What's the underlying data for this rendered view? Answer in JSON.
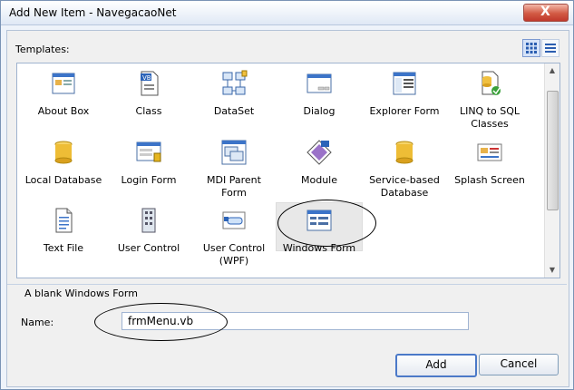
{
  "window": {
    "title": "Add New Item - NavegacaoNet",
    "close_label": "X"
  },
  "templates": {
    "label": "Templates:",
    "view_buttons": [
      "large-icons-icon",
      "list-view-icon"
    ],
    "items": [
      {
        "label": "About Box",
        "icon": "about-box-icon"
      },
      {
        "label": "Class",
        "icon": "class-icon"
      },
      {
        "label": "DataSet",
        "icon": "dataset-icon"
      },
      {
        "label": "Dialog",
        "icon": "dialog-icon"
      },
      {
        "label": "Explorer Form",
        "icon": "explorer-form-icon"
      },
      {
        "label": "LINQ to SQL Classes",
        "icon": "linq-to-sql-icon"
      },
      {
        "label": "Local Database",
        "icon": "database-icon"
      },
      {
        "label": "Login Form",
        "icon": "login-form-icon"
      },
      {
        "label": "MDI Parent Form",
        "icon": "mdi-parent-form-icon"
      },
      {
        "label": "Module",
        "icon": "module-icon"
      },
      {
        "label": "Service-based Database",
        "icon": "service-database-icon"
      },
      {
        "label": "Splash Screen",
        "icon": "splash-screen-icon"
      },
      {
        "label": "Text File",
        "icon": "text-file-icon"
      },
      {
        "label": "User Control",
        "icon": "user-control-icon"
      },
      {
        "label": "User Control (WPF)",
        "icon": "wpf-user-control-icon"
      },
      {
        "label": "Windows Form",
        "icon": "windows-form-icon"
      }
    ]
  },
  "description": "A blank Windows Form",
  "name_field": {
    "label": "Name:",
    "value": "frmMenu.vb"
  },
  "buttons": {
    "add": "Add",
    "cancel": "Cancel"
  }
}
